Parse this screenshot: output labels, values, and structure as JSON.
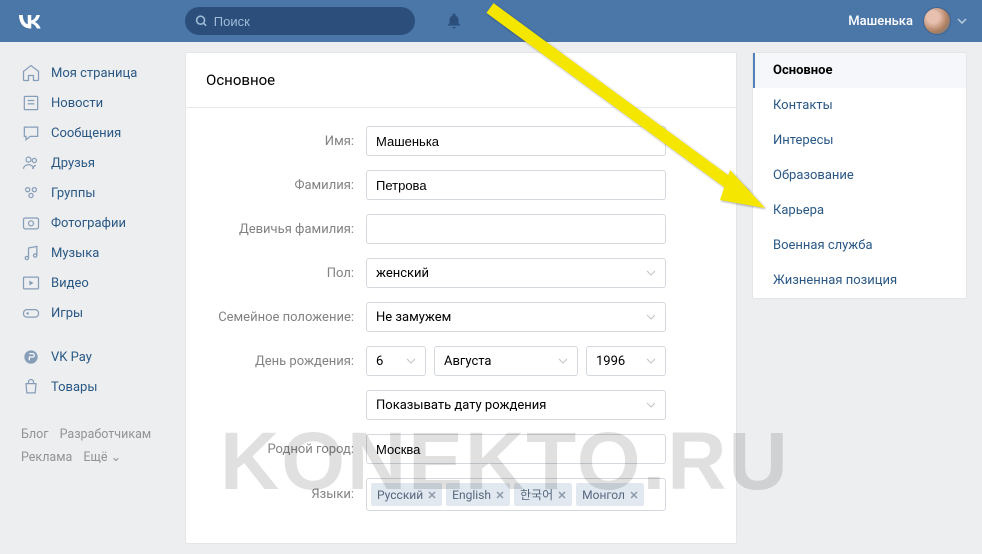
{
  "header": {
    "search_placeholder": "Поиск",
    "username": "Машенька"
  },
  "sidebar": {
    "items": [
      {
        "label": "Моя страница",
        "icon": "home"
      },
      {
        "label": "Новости",
        "icon": "news"
      },
      {
        "label": "Сообщения",
        "icon": "messages"
      },
      {
        "label": "Друзья",
        "icon": "friends"
      },
      {
        "label": "Группы",
        "icon": "groups"
      },
      {
        "label": "Фотографии",
        "icon": "photos"
      },
      {
        "label": "Музыка",
        "icon": "music"
      },
      {
        "label": "Видео",
        "icon": "video"
      },
      {
        "label": "Игры",
        "icon": "games"
      }
    ],
    "secondary": [
      {
        "label": "VK Pay",
        "icon": "pay"
      },
      {
        "label": "Товары",
        "icon": "shop"
      }
    ],
    "footer": [
      "Блог",
      "Разработчикам",
      "Реклама",
      "Ещё ⌄"
    ]
  },
  "form": {
    "title": "Основное",
    "labels": {
      "first_name": "Имя:",
      "last_name": "Фамилия:",
      "maiden_name": "Девичья фамилия:",
      "sex": "Пол:",
      "relation": "Семейное положение:",
      "birthday": "День рождения:",
      "hometown": "Родной город:",
      "languages": "Языки:"
    },
    "values": {
      "first_name": "Машенька",
      "last_name": "Петрова",
      "maiden_name": "",
      "sex": "женский",
      "relation": "Не замужем",
      "birthday_day": "6",
      "birthday_month": "Августа",
      "birthday_year": "1996",
      "birthday_visibility": "Показывать дату рождения",
      "hometown": "Москва",
      "languages": [
        "Русский",
        "English",
        "한국어",
        "Монгол"
      ]
    }
  },
  "right_nav": [
    {
      "label": "Основное",
      "active": true
    },
    {
      "label": "Контакты"
    },
    {
      "label": "Интересы"
    },
    {
      "label": "Образование"
    },
    {
      "label": "Карьера"
    },
    {
      "label": "Военная служба"
    },
    {
      "label": "Жизненная позиция"
    }
  ],
  "watermark": "KONEKTO.RU"
}
